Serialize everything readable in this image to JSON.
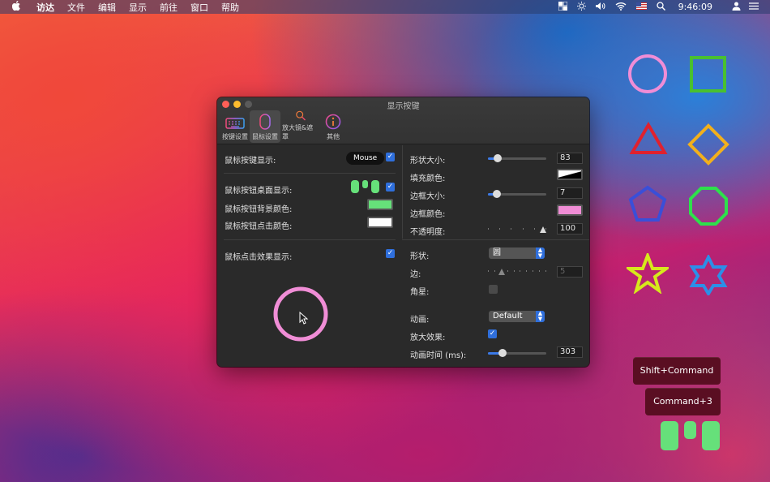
{
  "menubar": {
    "items": [
      "访达",
      "文件",
      "编辑",
      "显示",
      "前往",
      "窗口",
      "帮助"
    ],
    "clock": "9:46:09"
  },
  "window": {
    "title": "显示按键",
    "toolbar": [
      {
        "label": "按键设置",
        "icon": "keyboard-icon"
      },
      {
        "label": "鼠标设置",
        "icon": "mouse-icon"
      },
      {
        "label": "放大镜&遮罩",
        "icon": "magnifier-icon"
      },
      {
        "label": "其他",
        "icon": "info-icon"
      }
    ],
    "left": {
      "mouse_key_display": {
        "label": "鼠标按键显示:",
        "pill": "Mouse",
        "checked": true
      },
      "mouse_desktop_display": {
        "label": "鼠标按钮桌面显示:",
        "checked": true
      },
      "mouse_bg_color": {
        "label": "鼠标按钮背景颜色:",
        "color": "#66e07a"
      },
      "mouse_click_color": {
        "label": "鼠标按钮点击颜色:",
        "color": "#ffffff"
      },
      "click_effect_display": {
        "label": "鼠标点击效果显示:",
        "checked": true
      },
      "preview_ring_color": "#f08dd6"
    },
    "right": {
      "shape_size": {
        "label": "形状大小:",
        "value": "83",
        "fraction": 0.15
      },
      "fill_color": {
        "label": "填充颜色:"
      },
      "border_size": {
        "label": "边框大小:",
        "value": "7",
        "fraction": 0.14
      },
      "border_color": {
        "label": "边框颜色:",
        "color": "#f08dd6"
      },
      "opacity": {
        "label": "不透明度:",
        "value": "100",
        "fraction": 1.0
      },
      "shape": {
        "label": "形状:",
        "value": "圆"
      },
      "sides": {
        "label": "边:",
        "value": "5"
      },
      "star": {
        "label": "角星:",
        "checked": false
      },
      "animation": {
        "label": "动画:",
        "value": "Default"
      },
      "zoom_effect": {
        "label": "放大效果:",
        "checked": true
      },
      "anim_time": {
        "label": "动画时间 (ms):",
        "value": "303",
        "fraction": 0.25
      }
    }
  },
  "hud": {
    "line1": "Shift+Command",
    "line2": "Command+3"
  },
  "colors": {
    "accent": "#2f6fdc",
    "mouse_green": "#66e07a",
    "hud_bg": "#5a0e22"
  }
}
